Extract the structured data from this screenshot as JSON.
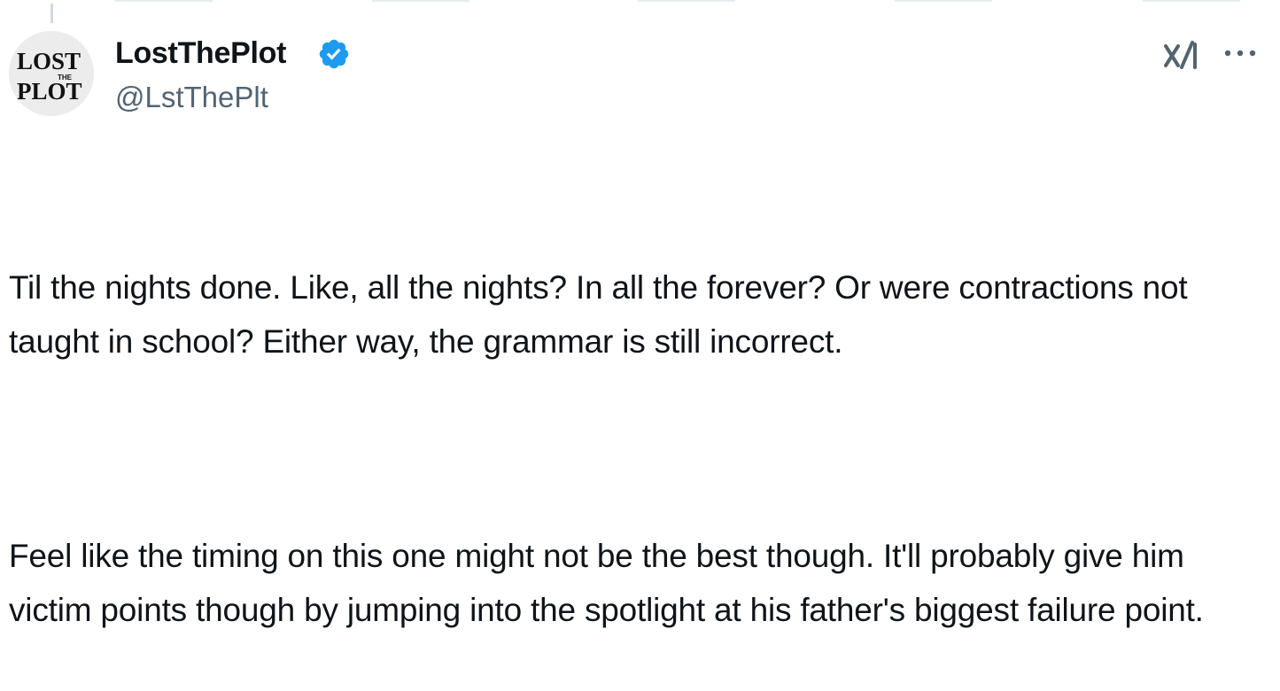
{
  "tweet": {
    "author": {
      "display_name": "LostThePlot",
      "handle": "@LstThePlt",
      "verified": true,
      "avatar_text": {
        "line1": "LOST",
        "line2": "THE",
        "line3": "PLOT"
      }
    },
    "paragraphs": [
      "Til the nights done. Like, all the nights? In all the forever? Or were contractions not taught in school? Either way, the grammar is still incorrect.",
      "Feel like the timing on this one might not be the best though. It'll probably give him victim points though by jumping into the spotlight at his father's biggest failure point."
    ],
    "actions": {
      "grok_icon": "grok-icon",
      "more_icon": "more-icon"
    }
  },
  "colors": {
    "text": "#0f1419",
    "secondary_text": "#536471",
    "verified_blue": "#1d9bf0",
    "thread_line": "#cfd9de"
  }
}
